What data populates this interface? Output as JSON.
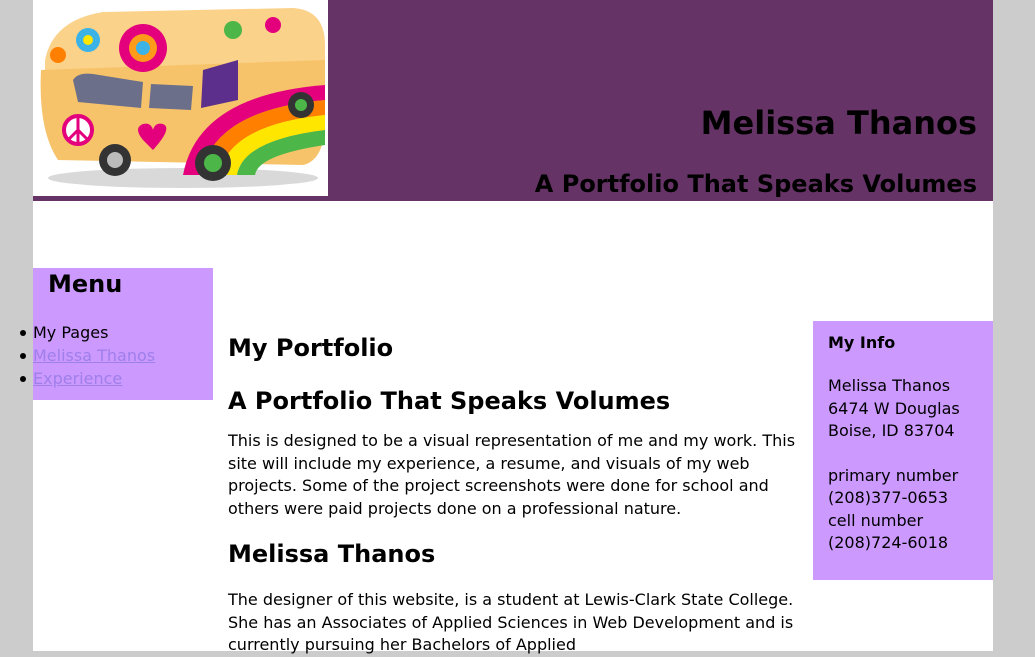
{
  "header": {
    "title": "Melissa Thanos",
    "tagline": "A Portfolio That Speaks Volumes",
    "colors": {
      "background": "#663366",
      "page": "#ffffff",
      "outer": "#cccccc"
    }
  },
  "menu": {
    "heading": "Menu",
    "items": [
      {
        "label": "My Pages",
        "is_link": false
      },
      {
        "label": "Melissa Thanos",
        "is_link": true
      },
      {
        "label": "Experience",
        "is_link": true
      }
    ],
    "colors": {
      "background": "#cc99ff",
      "link": "#9f7fea"
    }
  },
  "main": {
    "heading": "My Portfolio",
    "subheading": "A Portfolio That Speaks Volumes",
    "intro": "This is designed to be a visual representation of me and my work. This site will include my experience, a resume, and visuals of my web projects. Some of the project screenshots were done for school and others were paid projects done on a professional nature.",
    "designer_heading": "Melissa Thanos",
    "designer_text": "The designer of this website, is a student at Lewis-Clark State College. She has an Associates of Applied Sciences in Web Development and is currently pursuing her Bachelors of Applied"
  },
  "info": {
    "heading": "My Info",
    "name": "Melissa Thanos",
    "street": "6474 W Douglas",
    "city": "Boise, ID 83704",
    "primary_label": "primary number",
    "primary_phone": "(208)377-0653",
    "cell_label": "cell number",
    "cell_phone": "(208)724-6018",
    "colors": {
      "background": "#cc99ff"
    }
  },
  "logo": {
    "icon": "hippie-van-icon"
  }
}
